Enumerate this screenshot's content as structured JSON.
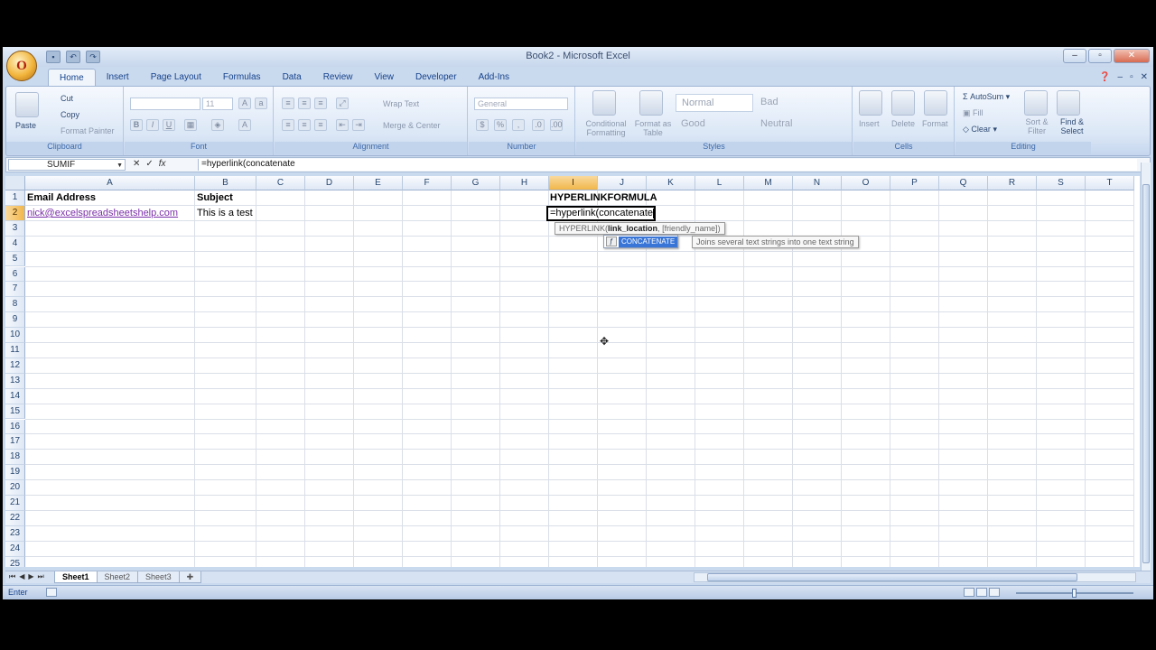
{
  "window": {
    "title": "Book2 - Microsoft Excel"
  },
  "quick_access": [
    "save-icon",
    "undo-icon",
    "redo-icon"
  ],
  "ribbon_tabs": [
    "Home",
    "Insert",
    "Page Layout",
    "Formulas",
    "Data",
    "Review",
    "View",
    "Developer",
    "Add-Ins"
  ],
  "ribbon": {
    "clipboard": {
      "paste": "Paste",
      "cut": "Cut",
      "copy": "Copy",
      "format_painter": "Format Painter",
      "label": "Clipboard"
    },
    "font": {
      "label": "Font",
      "size": "11"
    },
    "alignment": {
      "wrap_text": "Wrap Text",
      "merge_center": "Merge & Center",
      "label": "Alignment"
    },
    "number": {
      "format": "General",
      "label": "Number"
    },
    "styles": {
      "conditional": "Conditional Formatting",
      "format_table": "Format as Table",
      "normal": "Normal",
      "bad": "Bad",
      "good": "Good",
      "neutral": "Neutral",
      "label": "Styles"
    },
    "cells": {
      "insert": "Insert",
      "delete": "Delete",
      "format": "Format",
      "label": "Cells"
    },
    "editing": {
      "autosum": "AutoSum",
      "fill": "Fill",
      "clear": "Clear",
      "sort_filter": "Sort & Filter",
      "find_select": "Find & Select",
      "label": "Editing"
    }
  },
  "formula_bar": {
    "name_box": "SUMIF",
    "formula": "=hyperlink(concatenate"
  },
  "columns": [
    "A",
    "B",
    "C",
    "D",
    "E",
    "F",
    "G",
    "H",
    "I",
    "J",
    "K",
    "L",
    "M",
    "N",
    "O",
    "P",
    "Q",
    "R",
    "S",
    "T"
  ],
  "rows": [
    "1",
    "2",
    "3",
    "4",
    "5",
    "6",
    "7",
    "8",
    "9",
    "10",
    "11",
    "12",
    "13",
    "14",
    "15",
    "16",
    "17",
    "18",
    "19",
    "20",
    "21",
    "22",
    "23",
    "24",
    "25"
  ],
  "cells": {
    "A1": "Email Address",
    "B1": "Subject",
    "I1": "HYPERLINKFORMULA",
    "A2": "nick@excelspreadsheetshelp.com",
    "B2": "This is a test",
    "I2": "=hyperlink(concatenate"
  },
  "tooltip_signature": {
    "fn": "HYPERLINK(",
    "arg1": "link_location",
    "sep": ",",
    "arg2": "[friendly_name]",
    "close": ")"
  },
  "autocomplete": {
    "item": "CONCATENATE",
    "description": "Joins several text strings into one text string"
  },
  "sheet_tabs": [
    "Sheet1",
    "Sheet2",
    "Sheet3"
  ],
  "status": {
    "mode": "Enter"
  }
}
